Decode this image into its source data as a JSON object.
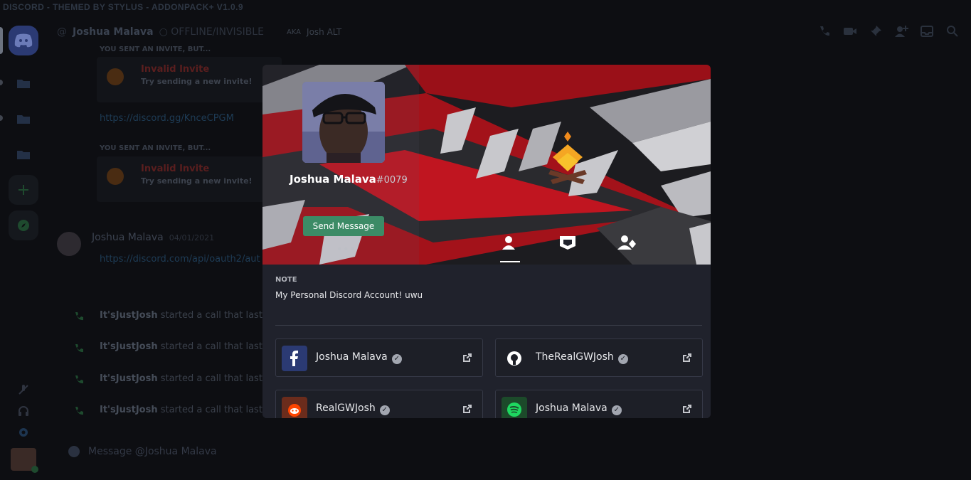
{
  "app": {
    "title_bar": "DISCORD - THEMED BY STYLUS - ADDONPACK+ V1.0.9"
  },
  "header": {
    "at_symbol": "@",
    "name": "Joshua Malava",
    "status": "○ OFFLINE/INVISIBLE",
    "aka_label": "AKA",
    "aka_value": "Josh ALT"
  },
  "messages": {
    "invite_label_1": "YOU SENT AN INVITE, BUT...",
    "invite_title_1": "Invalid Invite",
    "invite_sub_1": "Try sending a new invite!",
    "link_1": "https://discord.gg/KnceCPGM",
    "invite_label_2": "YOU SENT AN INVITE, BUT...",
    "invite_title_2": "Invalid Invite",
    "invite_sub_2": "Try sending a new invite!",
    "author": "Joshua Malava",
    "date": "04/01/2021",
    "link_2": "https://discord.com/api/oauth2/aut",
    "calls": [
      {
        "name": "It'sJustJosh",
        "text": " started a call that laste"
      },
      {
        "name": "It'sJustJosh",
        "text": " started a call that laste"
      },
      {
        "name": "It'sJustJosh",
        "text": " started a call that laste"
      },
      {
        "name": "It'sJustJosh",
        "text": " started a call that laste"
      }
    ]
  },
  "composer": {
    "placeholder": "Message @Joshua Malava"
  },
  "profile": {
    "username": "Joshua Malava",
    "discriminator": "#0079",
    "send_message_label": "Send Message",
    "more_label": "•••",
    "note_label": "NOTE",
    "note_text": "My Personal Discord Account! uwu",
    "accounts": [
      {
        "platform_icon": "facebook-icon",
        "name": "Joshua Malava",
        "color": "#2b3a73"
      },
      {
        "platform_icon": "github-icon",
        "name": "TheRealGWJosh",
        "color": "#1d1f27"
      },
      {
        "platform_icon": "reddit-icon",
        "name": "RealGWJosh",
        "color": "#6b2c1c"
      },
      {
        "platform_icon": "spotify-icon",
        "name": "Joshua Malava",
        "color": "#1c4a2a"
      }
    ],
    "verified_mark": "✓"
  },
  "colors": {
    "send_button": "#3c8b66",
    "banner_red": "#a3121a",
    "modal_bg": "#20222c"
  }
}
